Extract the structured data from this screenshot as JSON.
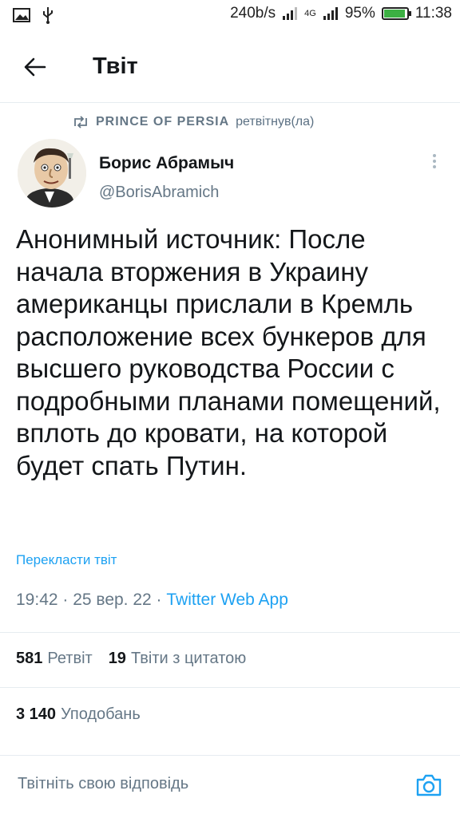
{
  "status_bar": {
    "speed": "240b/s",
    "network": "4G",
    "battery_percent": "95%",
    "battery_level": 0.95,
    "time": "11:38"
  },
  "header": {
    "title": "Твіт"
  },
  "retweet": {
    "retweeter": "PRINCE OF PERSIA",
    "suffix": "ретвітнув(ла)"
  },
  "author": {
    "name": "Борис Абрамыч",
    "handle": "@BorisAbramich"
  },
  "tweet": {
    "text": "Анонимный источник: После начала вторжения в Украину американцы прислали в Кремль расположение всех бункеров для высшего руководства России с подробными планами помещений, вплоть до кровати, на которой будет спать Путин.",
    "translate_label": "Перекласти твіт",
    "timestamp": "19:42 · 25 вер. 22 · ",
    "source": "Twitter Web App"
  },
  "stats": {
    "retweets_count": "581",
    "retweets_label": "Ретвіт",
    "quotes_count": "19",
    "quotes_label": "Твіти з цитатою",
    "likes_count": "3 140",
    "likes_label": "Уподобань"
  },
  "reply": {
    "placeholder": "Твітніть свою відповідь"
  },
  "icons": {
    "back": "arrow-left-icon",
    "retweet": "retweet-icon",
    "more": "more-vertical-icon",
    "camera": "camera-icon"
  },
  "colors": {
    "accent": "#1da1f2",
    "muted": "#657786",
    "text": "#14171a"
  }
}
